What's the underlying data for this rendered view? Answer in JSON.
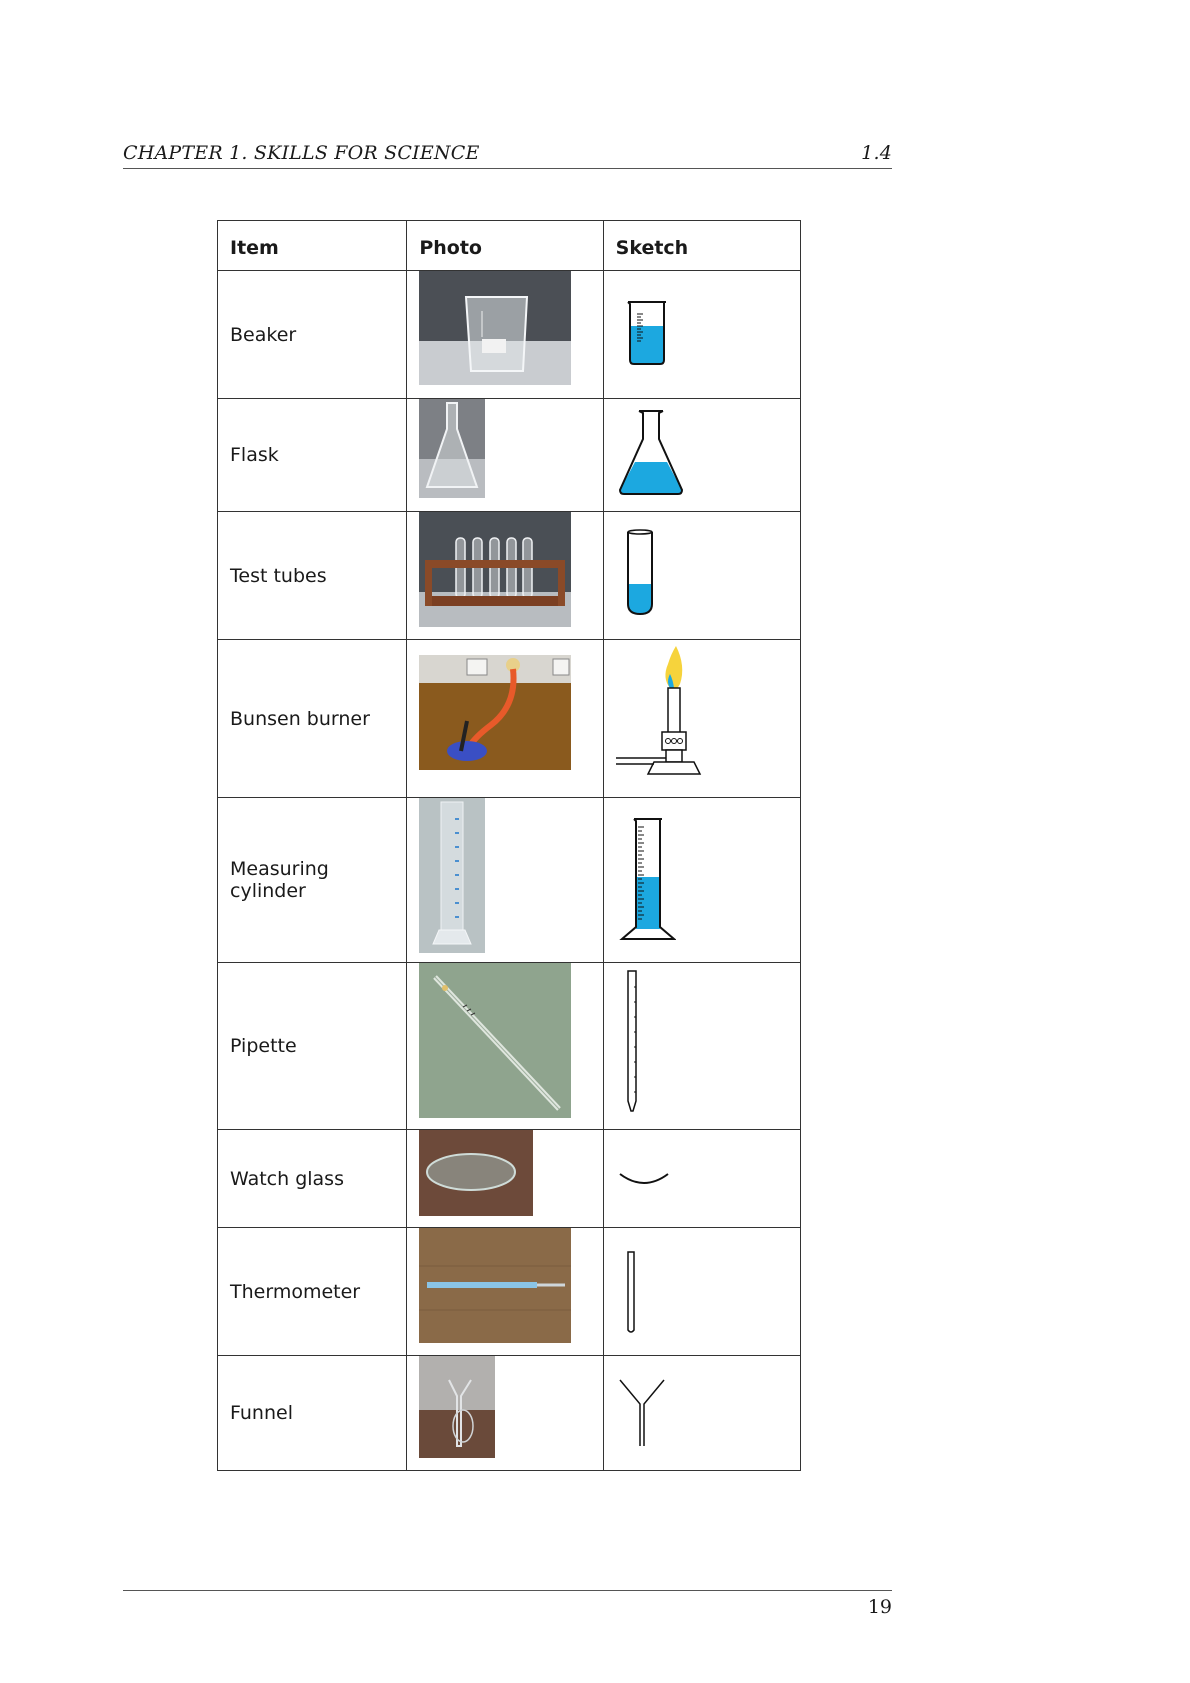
{
  "header": {
    "chapter": "CHAPTER 1.  SKILLS FOR SCIENCE",
    "section": "1.4"
  },
  "table": {
    "columns": [
      "Item",
      "Photo",
      "Sketch"
    ],
    "rows": [
      {
        "item": "Beaker"
      },
      {
        "item": "Flask"
      },
      {
        "item": "Test tubes"
      },
      {
        "item": "Bunsen burner"
      },
      {
        "item": "Measuring cylinder"
      },
      {
        "item": "Pipette"
      },
      {
        "item": "Watch glass"
      },
      {
        "item": "Thermometer"
      },
      {
        "item": "Funnel"
      }
    ]
  },
  "footer": {
    "page_number": "19"
  },
  "colors": {
    "liquid": "#1ca8e0",
    "flame": "#f6d33c"
  }
}
